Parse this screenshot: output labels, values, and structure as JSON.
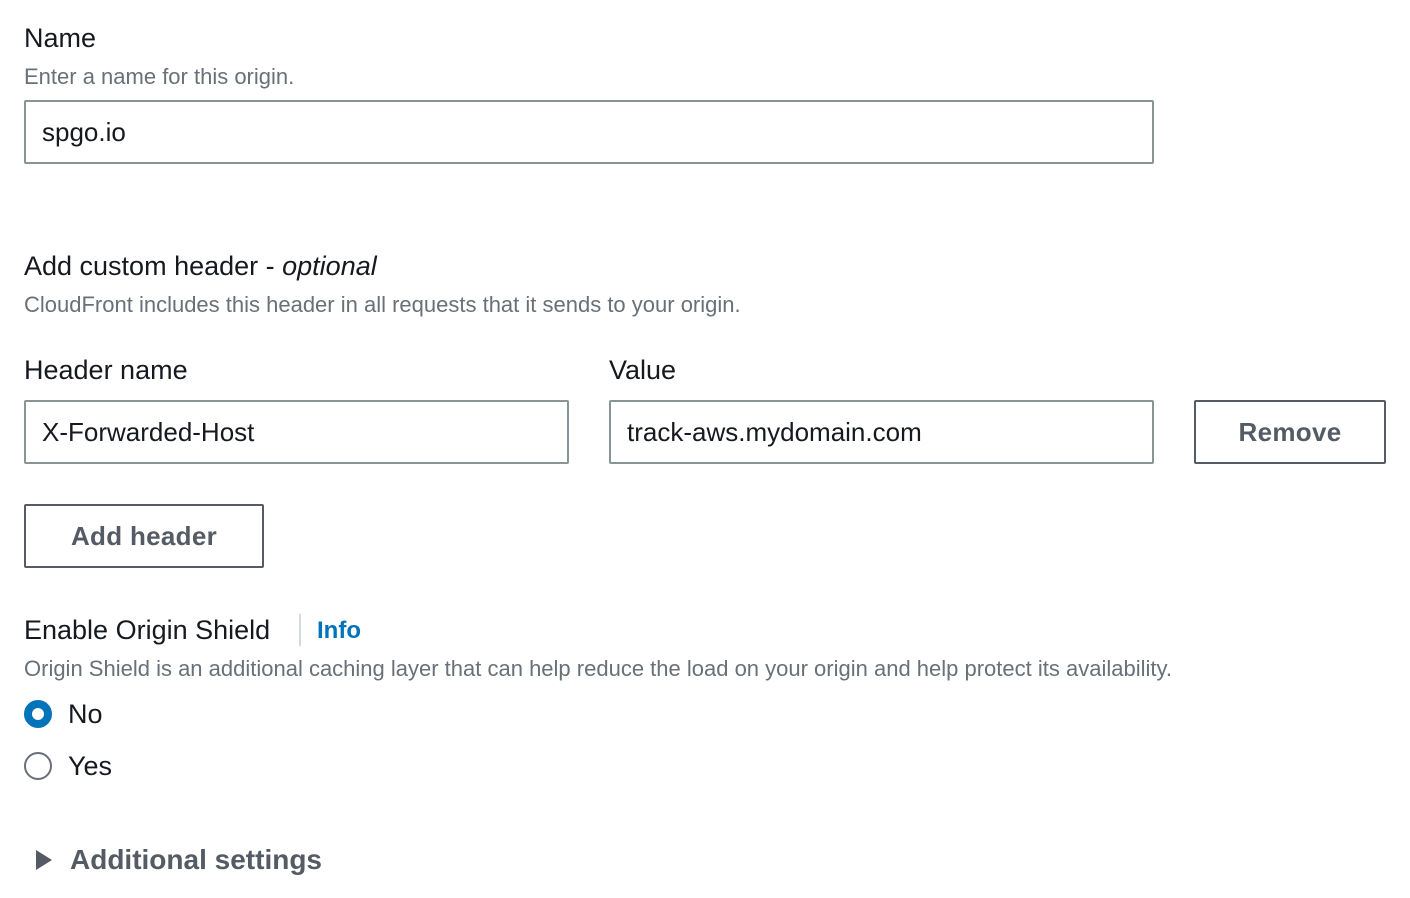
{
  "name_section": {
    "label": "Name",
    "description": "Enter a name for this origin.",
    "value": "spgo.io"
  },
  "custom_header": {
    "title": "Add custom header - ",
    "title_optional": "optional",
    "description": "CloudFront includes this header in all requests that it sends to your origin.",
    "header_name_label": "Header name",
    "value_label": "Value",
    "header_name_value": "X-Forwarded-Host",
    "value_value": "track-aws.mydomain.com",
    "remove_label": "Remove",
    "add_label": "Add header"
  },
  "origin_shield": {
    "label": "Enable Origin Shield",
    "info_link": "Info",
    "description": "Origin Shield is an additional caching layer that can help reduce the load on your origin and help protect its availability.",
    "options": [
      {
        "label": "No",
        "selected": true
      },
      {
        "label": "Yes",
        "selected": false
      }
    ]
  },
  "additional_settings": {
    "label": "Additional settings"
  },
  "colors": {
    "accent": "#0073bb",
    "text": "#16191f",
    "muted": "#687078",
    "border": "#879596",
    "button": "#545b64"
  },
  "icons": {
    "expander": "caret-right-icon"
  }
}
